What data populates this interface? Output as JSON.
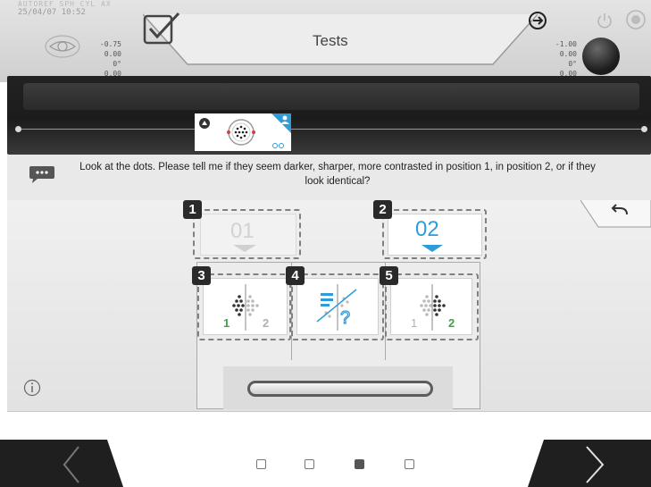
{
  "header": {
    "datetime": "25/04/07   10:52",
    "datetime_faint": "AUTOREF  SPH  CYL  AX",
    "left_readout": [
      "-0.75",
      "0.00",
      "0°",
      "0.00"
    ],
    "right_readout": [
      "-1.00",
      "0.00",
      "0°",
      "0.00"
    ],
    "tab_title": "Tests",
    "icons": [
      "eye-icon",
      "check-box-icon",
      "connect-icon",
      "power-icon",
      "record-icon"
    ]
  },
  "instruction": {
    "text": "Look at the dots. Please tell me if they seem darker, sharper, more contrasted in position 1, in position 2, or if they look identical?"
  },
  "positions": {
    "pos1": {
      "number": "1",
      "label": "01"
    },
    "pos2": {
      "number": "2",
      "label": "02"
    }
  },
  "answers": {
    "opt3": {
      "number": "3",
      "label_left": "1",
      "label_right": "2",
      "selected_side": "1"
    },
    "opt4": {
      "number": "4",
      "meaning": "identical / don't know"
    },
    "opt5": {
      "number": "5",
      "label_left": "1",
      "label_right": "2",
      "selected_side": "2"
    }
  },
  "nav": {
    "pages": 4,
    "current_page": 3
  },
  "colors": {
    "accent_blue": "#2f9bd8",
    "accent_green": "#3aa548",
    "badge_dark": "#2a2a2a"
  }
}
